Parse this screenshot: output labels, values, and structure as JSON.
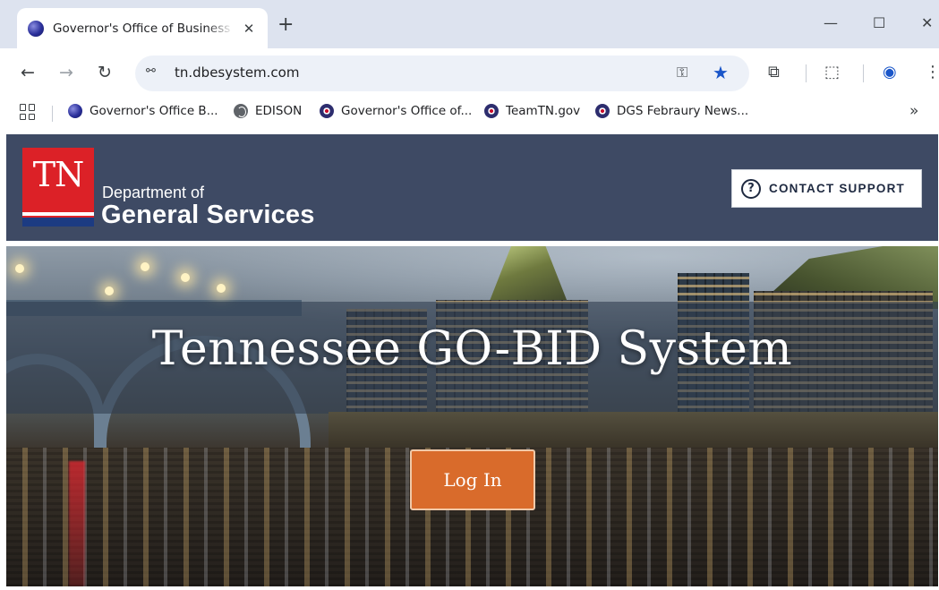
{
  "browser": {
    "tab": {
      "title": "Governor's Office of Business In",
      "close": "✕"
    },
    "new_tab": "+",
    "window_controls": {
      "minimize": "—",
      "maximize": "☐",
      "close": "✕"
    },
    "toolbar": {
      "back": "←",
      "forward": "→",
      "reload": "↻"
    },
    "address_bar": {
      "site_info": "⚯",
      "url": "tn.dbesystem.com",
      "key": "⚿",
      "star": "★"
    },
    "toolbar_right": {
      "extensions": "⧉",
      "reading": "⬚",
      "profile": "◉",
      "menu": "⋮"
    },
    "bookmarks": [
      {
        "label": "Governor's Office B...",
        "icon": "globe-icon"
      },
      {
        "label": "EDISON",
        "icon": "edison-icon"
      },
      {
        "label": "Governor's Office of...",
        "icon": "tn-seal-icon"
      },
      {
        "label": "TeamTN.gov",
        "icon": "tn-seal-icon"
      },
      {
        "label": "DGS Febraury News...",
        "icon": "tn-seal-icon"
      }
    ],
    "bookmarks_more": "»"
  },
  "site": {
    "logo": {
      "text": "TN"
    },
    "department": {
      "line1": "Department of",
      "line2": "General Services"
    },
    "contact_support": {
      "icon": "?",
      "label": "CONTACT SUPPORT"
    },
    "hero": {
      "title": "Tennessee GO-BID System",
      "login_label": "Log In"
    },
    "colors": {
      "header_bg": "#3e4a64",
      "logo_red": "#dc2127",
      "logo_blue": "#1c3b82",
      "login_orange": "#d96b2b"
    }
  }
}
